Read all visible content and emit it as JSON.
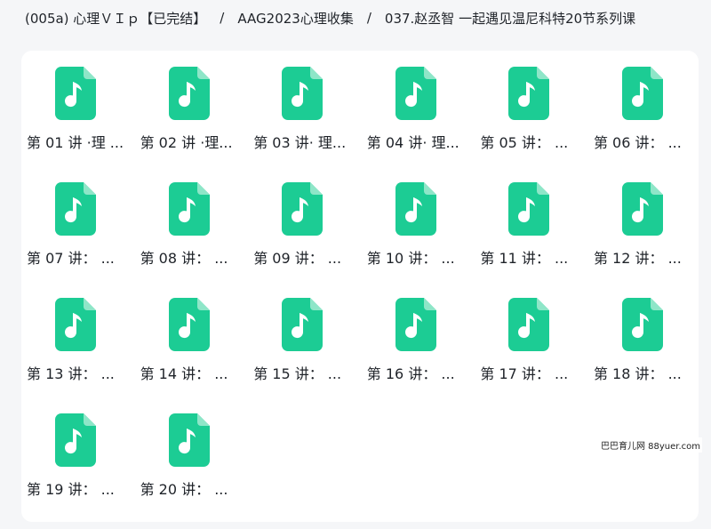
{
  "breadcrumb": {
    "items": [
      "(005a) 心理ＶＩｐ【已完结】",
      "AAG2023心理收集",
      "037.赵丞智 一起遇见温尼科特20节系列课"
    ],
    "separator": "/"
  },
  "files": [
    {
      "name": "第 01 讲 ·理 ..."
    },
    {
      "name": "第 02 讲 ·理..."
    },
    {
      "name": "第 03 讲· 理..."
    },
    {
      "name": "第 04 讲· 理..."
    },
    {
      "name": "第 05 讲： ..."
    },
    {
      "name": "第 06 讲： ..."
    },
    {
      "name": "第 07 讲： ..."
    },
    {
      "name": "第 08 讲： ..."
    },
    {
      "name": "第 09 讲： ..."
    },
    {
      "name": "第 10 讲： ..."
    },
    {
      "name": "第 11 讲： ..."
    },
    {
      "name": "第 12 讲： ..."
    },
    {
      "name": "第 13 讲： ..."
    },
    {
      "name": "第 14 讲： ..."
    },
    {
      "name": "第 15 讲： ..."
    },
    {
      "name": "第 16 讲： ..."
    },
    {
      "name": "第 17 讲： ..."
    },
    {
      "name": "第 18 讲： ..."
    },
    {
      "name": "第 19 讲： ..."
    },
    {
      "name": "第 20 讲： ..."
    }
  ],
  "file_icon": "audio-file-icon",
  "colors": {
    "icon_green": "#1ccc94",
    "panel_bg": "#ffffff",
    "page_bg": "#f5f6f8"
  },
  "watermark": "巴巴育儿网 88yuer.com"
}
